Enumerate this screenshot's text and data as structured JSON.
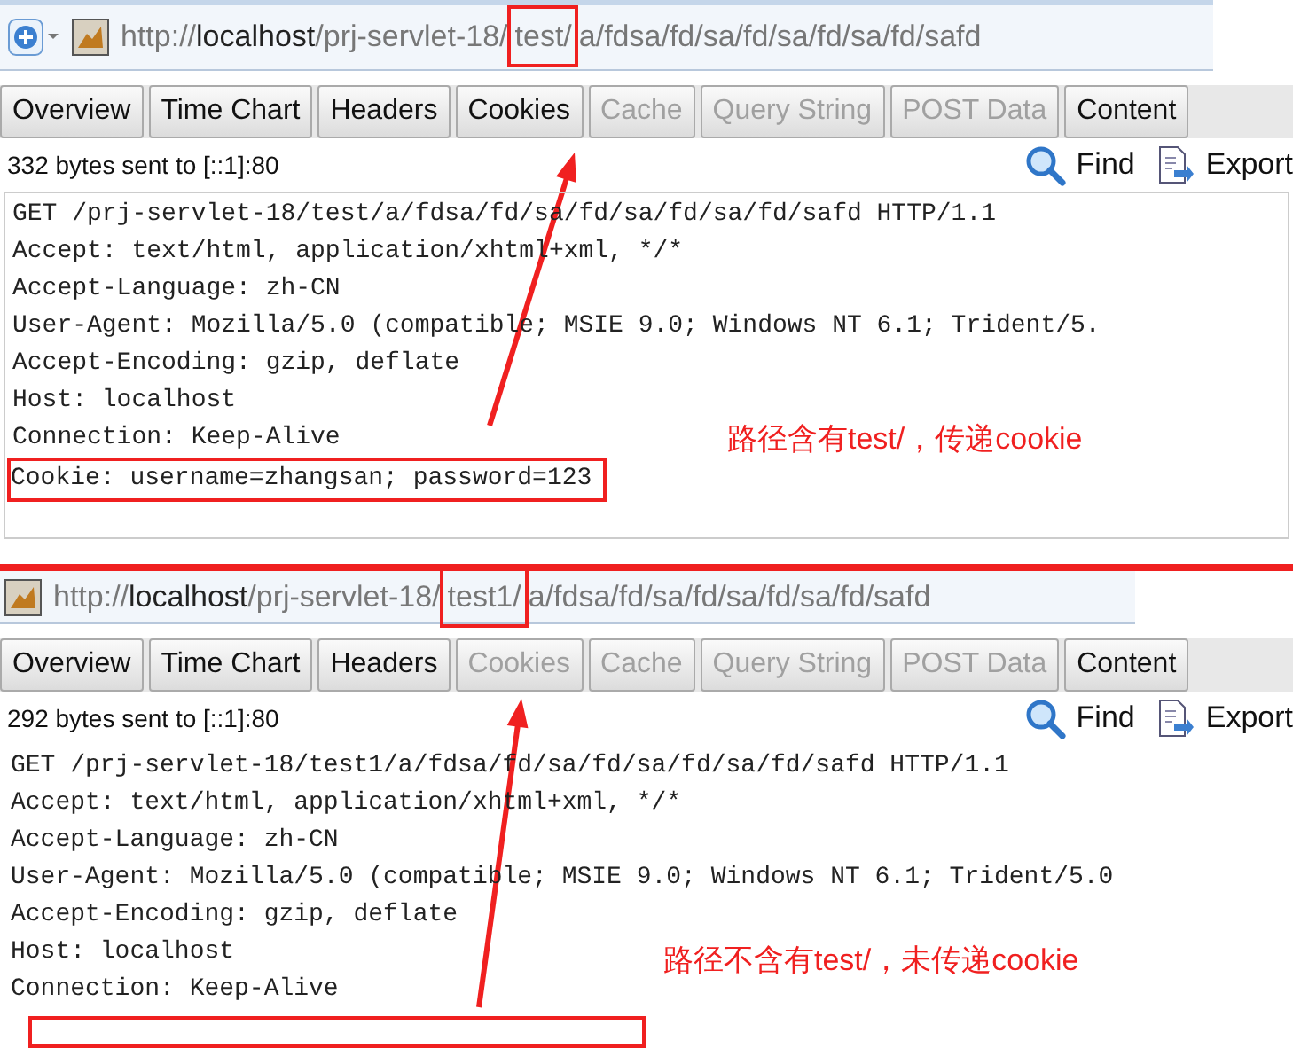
{
  "panels": [
    {
      "favorites_button": true,
      "url": {
        "scheme": "http://",
        "host": "localhost",
        "path": [
          {
            "text": "/prj-servlet-18/",
            "highlighted": false
          },
          {
            "text": "test/",
            "highlighted": true
          },
          {
            "text": "a/fdsa/fd/sa/fd/sa/fd/sa/fd/safd",
            "highlighted": false
          }
        ]
      },
      "tabs": [
        {
          "label": "Overview",
          "disabled": false
        },
        {
          "label": "Time Chart",
          "disabled": false
        },
        {
          "label": "Headers",
          "disabled": false
        },
        {
          "label": "Cookies",
          "disabled": false
        },
        {
          "label": "Cache",
          "disabled": true
        },
        {
          "label": "Query String",
          "disabled": true
        },
        {
          "label": "POST Data",
          "disabled": true
        },
        {
          "label": "Content",
          "disabled": false
        }
      ],
      "info": "332 bytes sent to [::1]:80",
      "find": "Find",
      "export": "Export",
      "lines": [
        {
          "text": "GET /prj-servlet-18/test/a/fdsa/fd/sa/fd/sa/fd/sa/fd/safd HTTP/1.1",
          "highlighted": false
        },
        {
          "text": "Accept: text/html, application/xhtml+xml, */*",
          "highlighted": false
        },
        {
          "text": "Accept-Language: zh-CN",
          "highlighted": false
        },
        {
          "text": "User-Agent: Mozilla/5.0 (compatible; MSIE 9.0; Windows NT 6.1; Trident/5.",
          "highlighted": false
        },
        {
          "text": "Accept-Encoding: gzip, deflate",
          "highlighted": false
        },
        {
          "text": "Host: localhost",
          "highlighted": false
        },
        {
          "text": "Connection: Keep-Alive",
          "highlighted": false
        },
        {
          "text": "Cookie: username=zhangsan; password=123",
          "highlighted": true
        }
      ],
      "missing_line_box": false,
      "annotation": "路径含有test/，传递cookie"
    },
    {
      "favorites_button": false,
      "url": {
        "scheme": "http://",
        "host": "localhost",
        "path": [
          {
            "text": "/prj-servlet-18/",
            "highlighted": false
          },
          {
            "text": "test1/",
            "highlighted": true
          },
          {
            "text": "a/fdsa/fd/sa/fd/sa/fd/sa/fd/safd",
            "highlighted": false
          }
        ]
      },
      "tabs": [
        {
          "label": "Overview",
          "disabled": false
        },
        {
          "label": "Time Chart",
          "disabled": false
        },
        {
          "label": "Headers",
          "disabled": false
        },
        {
          "label": "Cookies",
          "disabled": true
        },
        {
          "label": "Cache",
          "disabled": true
        },
        {
          "label": "Query String",
          "disabled": true
        },
        {
          "label": "POST Data",
          "disabled": true
        },
        {
          "label": "Content",
          "disabled": false
        }
      ],
      "info": "292 bytes sent to [::1]:80",
      "find": "Find",
      "export": "Export",
      "lines": [
        {
          "text": "GET /prj-servlet-18/test1/a/fdsa/fd/sa/fd/sa/fd/sa/fd/safd HTTP/1.1",
          "highlighted": false
        },
        {
          "text": "Accept: text/html, application/xhtml+xml, */*",
          "highlighted": false
        },
        {
          "text": "Accept-Language: zh-CN",
          "highlighted": false
        },
        {
          "text": "User-Agent: Mozilla/5.0 (compatible; MSIE 9.0; Windows NT 6.1; Trident/5.0",
          "highlighted": false
        },
        {
          "text": "Accept-Encoding: gzip, deflate",
          "highlighted": false
        },
        {
          "text": "Host: localhost",
          "highlighted": false
        },
        {
          "text": "Connection: Keep-Alive",
          "highlighted": false
        }
      ],
      "missing_line_box": true,
      "annotation": "路径不含有test/，未传递cookie"
    }
  ]
}
